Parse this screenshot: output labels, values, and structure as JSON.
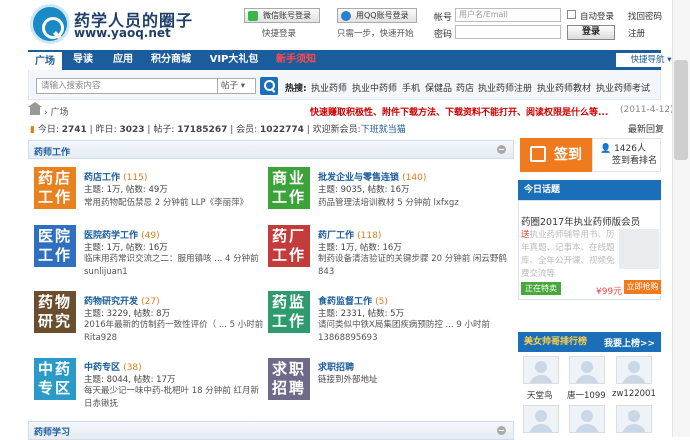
{
  "header": {
    "site_name": "药学人员的圈子",
    "site_url": "www.yaoq.net",
    "wechat_label": "微信账号登录",
    "wechat_hint": "快捷登录",
    "qq_label": "用QQ账号登录",
    "qq_hint": "只需一步，快速开始",
    "account_label": "帐号",
    "account_placeholder": "用户名/Email",
    "password_label": "密码",
    "remember_label": "自动登录",
    "forgot_label": "找回密码",
    "login_label": "登录",
    "register_label": "注册"
  },
  "nav": {
    "items": [
      "广场",
      "导读",
      "应用",
      "积分商城",
      "VIP大礼包",
      "新手须知"
    ],
    "quick_nav": "快捷导航"
  },
  "search": {
    "placeholder": "请输入搜索内容",
    "type": "帖子",
    "hot_label": "热搜:",
    "hot_terms": [
      "执业药师",
      "执业中药师",
      "手机",
      "保健品",
      "药店",
      "执业药师注册",
      "执业药师教材",
      "执业药师考试"
    ]
  },
  "breadcrumb": {
    "current": "广场"
  },
  "notice": {
    "text": "快速赚取积极性、附件下载方法、下载资料不能打开、阅读权限是什么等...",
    "date": "(2011-4-12)"
  },
  "stats": {
    "today_label": "今日:",
    "today": "2741",
    "yesterday_label": "昨日:",
    "yesterday": "3023",
    "posts_label": "帖子:",
    "posts": "17185267",
    "members_label": "会员:",
    "members": "1022774",
    "welcome_label": "欢迎新会员:",
    "newest_member": "下班就当猫",
    "newest_reply": "最新回复"
  },
  "forum": {
    "section_title": "药师工作",
    "section2_title": "药师学习",
    "boards": [
      {
        "icon_text": "药店工作",
        "color": "#e8821e",
        "name": "药店工作",
        "count": "(115)",
        "meta": "主题: 1万, 帖数: 49万",
        "last": "常用药物配伍禁忌 2 分钟前 LLP《李丽萍》"
      },
      {
        "icon_text": "商业工作",
        "color": "#3ba33a",
        "name": "批发企业与零售连锁",
        "count": "(140)",
        "meta": "主题: 9035, 帖数: 16万",
        "last": "药品管理法培训教材 5 分钟前 lxfxgz"
      },
      {
        "icon_text": "医院工作",
        "color": "#2f6fc0",
        "name": "医院药学工作",
        "count": "(49)",
        "meta": "主题: 1万, 帖数: 16万",
        "last": "临床用药常识交流之二：服用镇咳 ... 4 分钟前 sunlijuan1"
      },
      {
        "icon_text": "药厂工作",
        "color": "#c33b3b",
        "name": "药厂工作",
        "count": "(118)",
        "meta": "主题: 1万, 帖数: 16万",
        "last": "制药设备清洁验证的关键步骤 20 分钟前 闲云野鹤843"
      },
      {
        "icon_text": "药物研究",
        "color": "#6b4e2e",
        "name": "药物研究开发",
        "count": "(27)",
        "meta": "主题: 3229, 帖数: 8万",
        "last": "2016年最新的仿制药一致性评价（ ... 5 小时前 Rita928"
      },
      {
        "icon_text": "药监工作",
        "color": "#2e9a6e",
        "name": "食药监督工作",
        "count": "(5)",
        "meta": "主题: 2331, 帖数: 5万",
        "last": "请问类似中铁X局集团疾病预防控 ... 9 小时前 13868895693"
      },
      {
        "icon_text": "中药专区",
        "color": "#2a9bc8",
        "name": "中药专区",
        "count": "(38)",
        "meta": "主题: 8044, 帖数: 17万",
        "last": "每天最少记一味中药-枇杷叶 18 分钟前 红月新日赤锹抚"
      },
      {
        "icon_text": "求职招聘",
        "color": "#6f6a8a",
        "name": "求职招聘",
        "count": "",
        "meta": "链接到外部地址",
        "last": ""
      }
    ]
  },
  "sidebar": {
    "signin_label": "签到",
    "sign_count": "1426人",
    "sign_rank": "签到看排名",
    "today_topic_label": "今日话题",
    "promo_title": "药圈2017年执业药师版会员",
    "promo_text_highlight": "送",
    "promo_text": "执业药师辅导用书、历年真题、记事本、在线题库、全年公开课、视频免费交流等",
    "promo_tag": "正在特卖",
    "promo_price": "¥99元",
    "promo_buy": "立即抢购",
    "rank_label": "美女帅哥排行榜",
    "rank_more": "我要上榜>>",
    "users": [
      "天堂鸟",
      "唐一1099",
      "zw122001"
    ]
  }
}
